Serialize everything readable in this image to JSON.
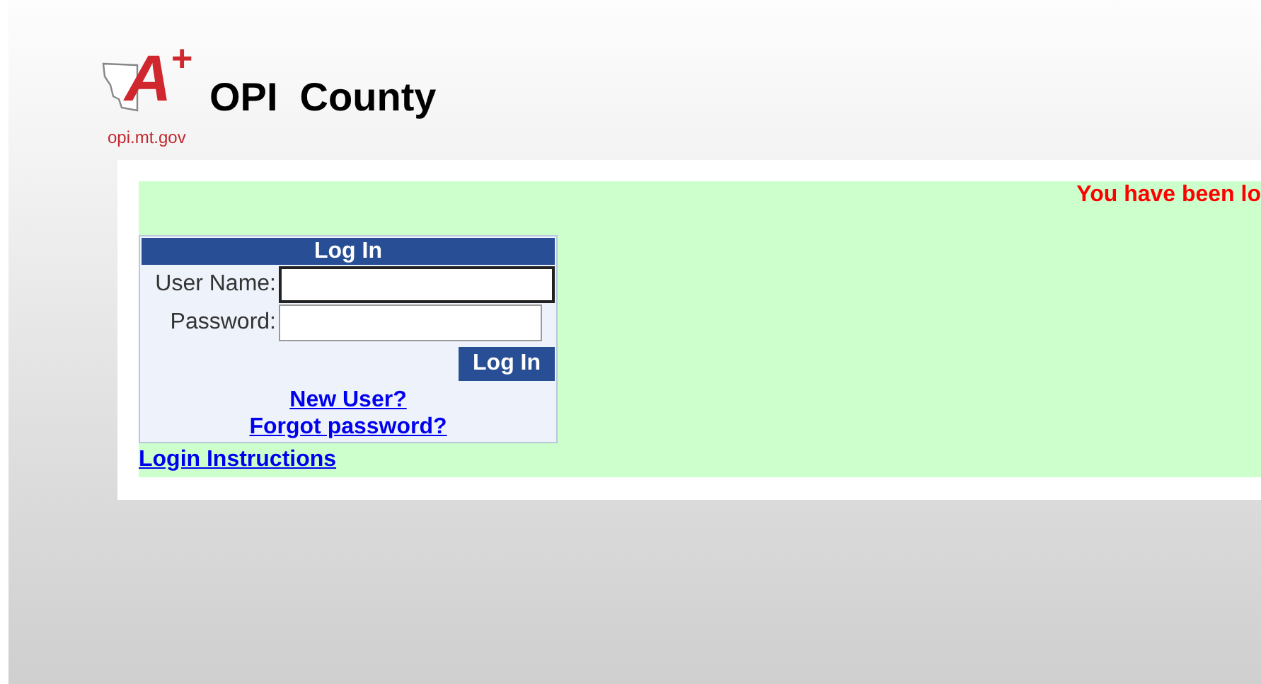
{
  "logo": {
    "letter": "A",
    "plus": "+",
    "caption": "opi.mt.gov"
  },
  "site_title": "OPI  County",
  "message": "You have been lo",
  "login": {
    "heading": "Log In",
    "fields": [
      {
        "label": "User Name:",
        "focused": true
      },
      {
        "label": "Password:",
        "focused": false
      }
    ],
    "button": "Log In",
    "links": [
      "New User?",
      "Forgot password?"
    ]
  },
  "instructions_link": "Login Instructions"
}
